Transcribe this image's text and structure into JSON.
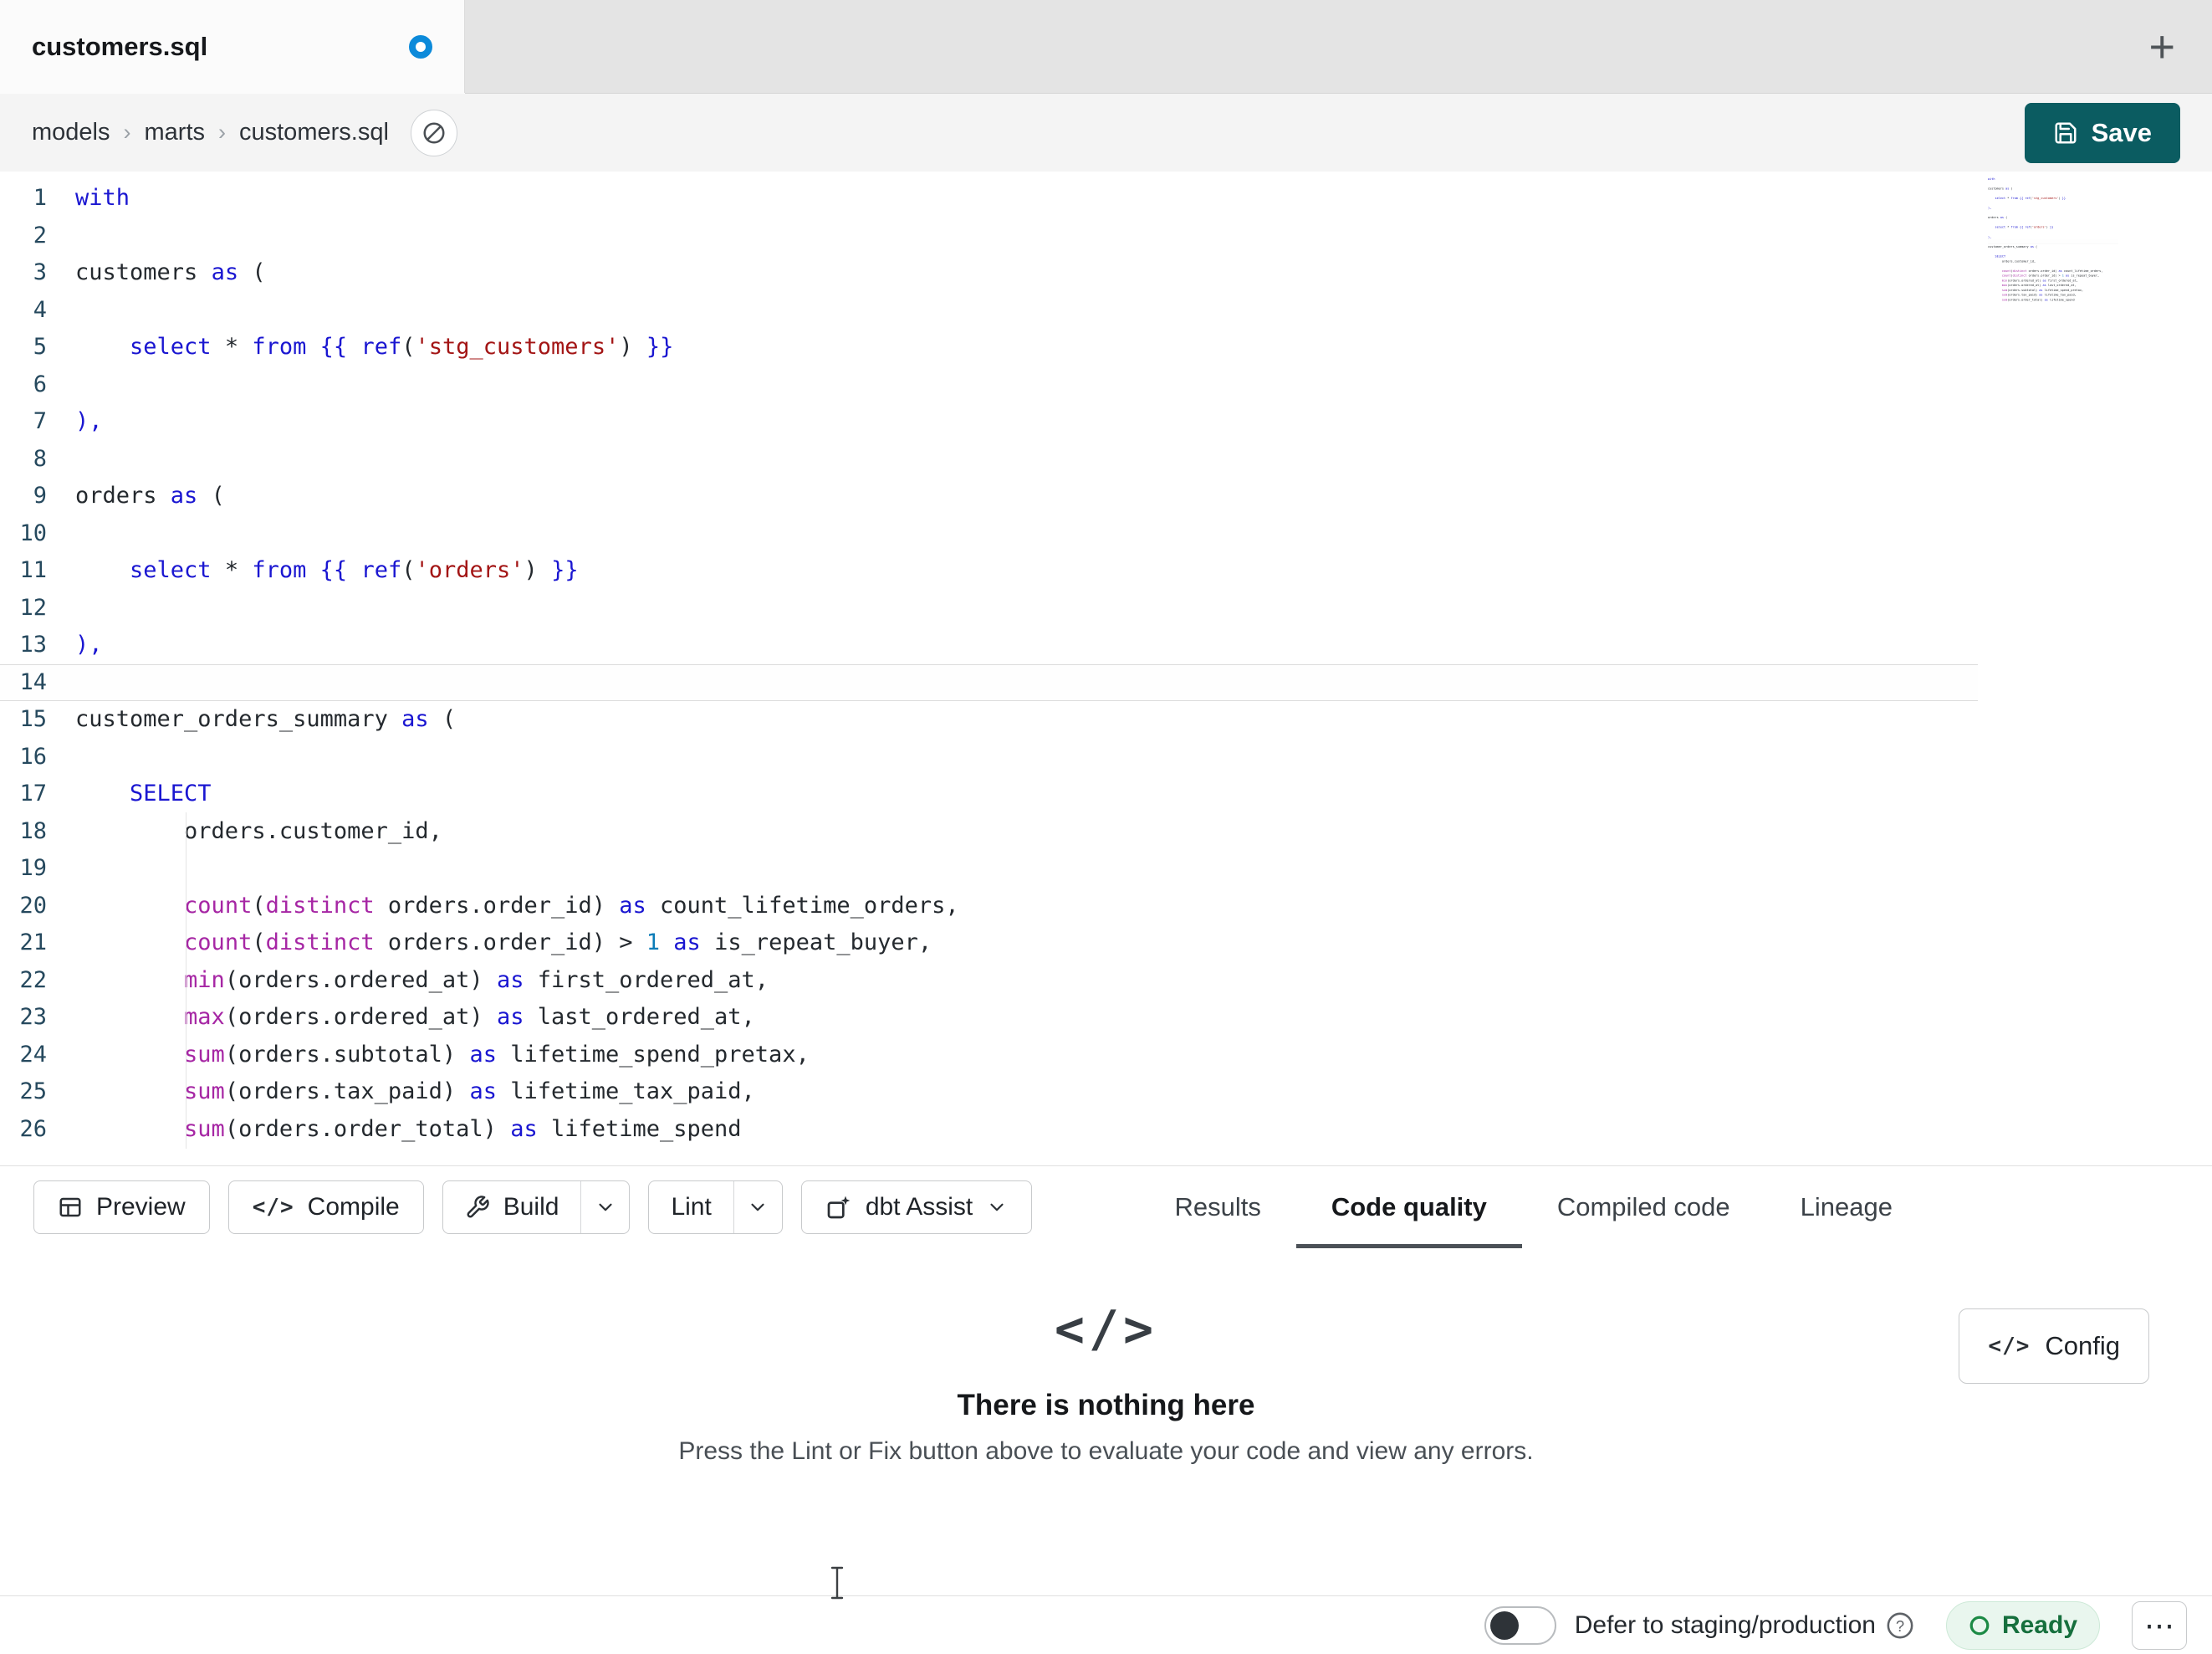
{
  "tab_bar": {
    "active_tab": "customers.sql"
  },
  "icons": {
    "plus": "+",
    "separator": "›",
    "code_glyph": "</>",
    "more": "⋯"
  },
  "breadcrumb": {
    "items": [
      "models",
      "marts",
      "customers.sql"
    ]
  },
  "save_button": {
    "label": "Save"
  },
  "editor": {
    "lines": [
      {
        "n": 1,
        "t": [
          [
            "kw",
            "with"
          ]
        ]
      },
      {
        "n": 2,
        "t": []
      },
      {
        "n": 3,
        "t": [
          [
            "txt",
            "customers "
          ],
          [
            "kw",
            "as"
          ],
          [
            "txt",
            " ("
          ]
        ]
      },
      {
        "n": 4,
        "t": []
      },
      {
        "n": 5,
        "t": [
          [
            "txt",
            "    "
          ],
          [
            "kw",
            "select"
          ],
          [
            "txt",
            " "
          ],
          [
            "op",
            "*"
          ],
          [
            "txt",
            " "
          ],
          [
            "kw",
            "from"
          ],
          [
            "txt",
            " "
          ],
          [
            "kw",
            "{{"
          ],
          [
            "txt",
            " "
          ],
          [
            "kw",
            "ref"
          ],
          [
            "txt",
            "("
          ],
          [
            "str",
            "'stg_customers'"
          ],
          [
            "txt",
            ")"
          ],
          [
            "txt",
            " "
          ],
          [
            "kw",
            "}}"
          ]
        ]
      },
      {
        "n": 6,
        "t": []
      },
      {
        "n": 7,
        "t": [
          [
            "kw",
            "),"
          ]
        ]
      },
      {
        "n": 8,
        "t": []
      },
      {
        "n": 9,
        "t": [
          [
            "txt",
            "orders "
          ],
          [
            "kw",
            "as"
          ],
          [
            "txt",
            " ("
          ]
        ]
      },
      {
        "n": 10,
        "t": []
      },
      {
        "n": 11,
        "t": [
          [
            "txt",
            "    "
          ],
          [
            "kw",
            "select"
          ],
          [
            "txt",
            " "
          ],
          [
            "op",
            "*"
          ],
          [
            "txt",
            " "
          ],
          [
            "kw",
            "from"
          ],
          [
            "txt",
            " "
          ],
          [
            "kw",
            "{{"
          ],
          [
            "txt",
            " "
          ],
          [
            "kw",
            "ref"
          ],
          [
            "txt",
            "("
          ],
          [
            "str",
            "'orders'"
          ],
          [
            "txt",
            ")"
          ],
          [
            "txt",
            " "
          ],
          [
            "kw",
            "}}"
          ]
        ]
      },
      {
        "n": 12,
        "t": []
      },
      {
        "n": 13,
        "t": [
          [
            "kw",
            "),"
          ]
        ]
      },
      {
        "n": 14,
        "t": [],
        "active": true
      },
      {
        "n": 15,
        "t": [
          [
            "txt",
            "customer_orders_summary "
          ],
          [
            "kw",
            "as"
          ],
          [
            "txt",
            " ("
          ]
        ]
      },
      {
        "n": 16,
        "t": []
      },
      {
        "n": 17,
        "t": [
          [
            "txt",
            "    "
          ],
          [
            "kw",
            "SELECT"
          ]
        ]
      },
      {
        "n": 18,
        "t": [
          [
            "txt",
            "        orders.customer_id,"
          ]
        ]
      },
      {
        "n": 19,
        "t": []
      },
      {
        "n": 20,
        "t": [
          [
            "txt",
            "        "
          ],
          [
            "fn",
            "count"
          ],
          [
            "txt",
            "("
          ],
          [
            "fn",
            "distinct"
          ],
          [
            "txt",
            " orders.order_id) "
          ],
          [
            "kw",
            "as"
          ],
          [
            "txt",
            " count_lifetime_orders,"
          ]
        ]
      },
      {
        "n": 21,
        "t": [
          [
            "txt",
            "        "
          ],
          [
            "fn",
            "count"
          ],
          [
            "txt",
            "("
          ],
          [
            "fn",
            "distinct"
          ],
          [
            "txt",
            " orders.order_id) "
          ],
          [
            "op",
            "> "
          ],
          [
            "num",
            "1"
          ],
          [
            "txt",
            " "
          ],
          [
            "kw",
            "as"
          ],
          [
            "txt",
            " is_repeat_buyer,"
          ]
        ]
      },
      {
        "n": 22,
        "t": [
          [
            "txt",
            "        "
          ],
          [
            "fn",
            "min"
          ],
          [
            "txt",
            "(orders.ordered_at) "
          ],
          [
            "kw",
            "as"
          ],
          [
            "txt",
            " first_ordered_at,"
          ]
        ]
      },
      {
        "n": 23,
        "t": [
          [
            "txt",
            "        "
          ],
          [
            "fn",
            "max"
          ],
          [
            "txt",
            "(orders.ordered_at) "
          ],
          [
            "kw",
            "as"
          ],
          [
            "txt",
            " last_ordered_at,"
          ]
        ]
      },
      {
        "n": 24,
        "t": [
          [
            "txt",
            "        "
          ],
          [
            "fn",
            "sum"
          ],
          [
            "txt",
            "(orders.subtotal) "
          ],
          [
            "kw",
            "as"
          ],
          [
            "txt",
            " lifetime_spend_pretax,"
          ]
        ]
      },
      {
        "n": 25,
        "t": [
          [
            "txt",
            "        "
          ],
          [
            "fn",
            "sum"
          ],
          [
            "txt",
            "(orders.tax_paid) "
          ],
          [
            "kw",
            "as"
          ],
          [
            "txt",
            " lifetime_tax_paid,"
          ]
        ]
      },
      {
        "n": 26,
        "t": [
          [
            "txt",
            "        "
          ],
          [
            "fn",
            "sum"
          ],
          [
            "txt",
            "(orders.order_total) "
          ],
          [
            "kw",
            "as"
          ],
          [
            "txt",
            " lifetime_spend"
          ]
        ]
      }
    ]
  },
  "toolbar": {
    "preview": "Preview",
    "compile": "Compile",
    "build": "Build",
    "lint": "Lint",
    "assist": "dbt Assist"
  },
  "result_tabs": {
    "items": [
      {
        "label": "Results",
        "active": false
      },
      {
        "label": "Code quality",
        "active": true
      },
      {
        "label": "Compiled code",
        "active": false
      },
      {
        "label": "Lineage",
        "active": false
      }
    ]
  },
  "empty_state": {
    "title": "There is nothing here",
    "message": "Press the Lint or Fix button above to evaluate your code and view any errors.",
    "config_label": "Config"
  },
  "status_bar": {
    "defer_label": "Defer to staging/production",
    "ready_label": "Ready"
  }
}
